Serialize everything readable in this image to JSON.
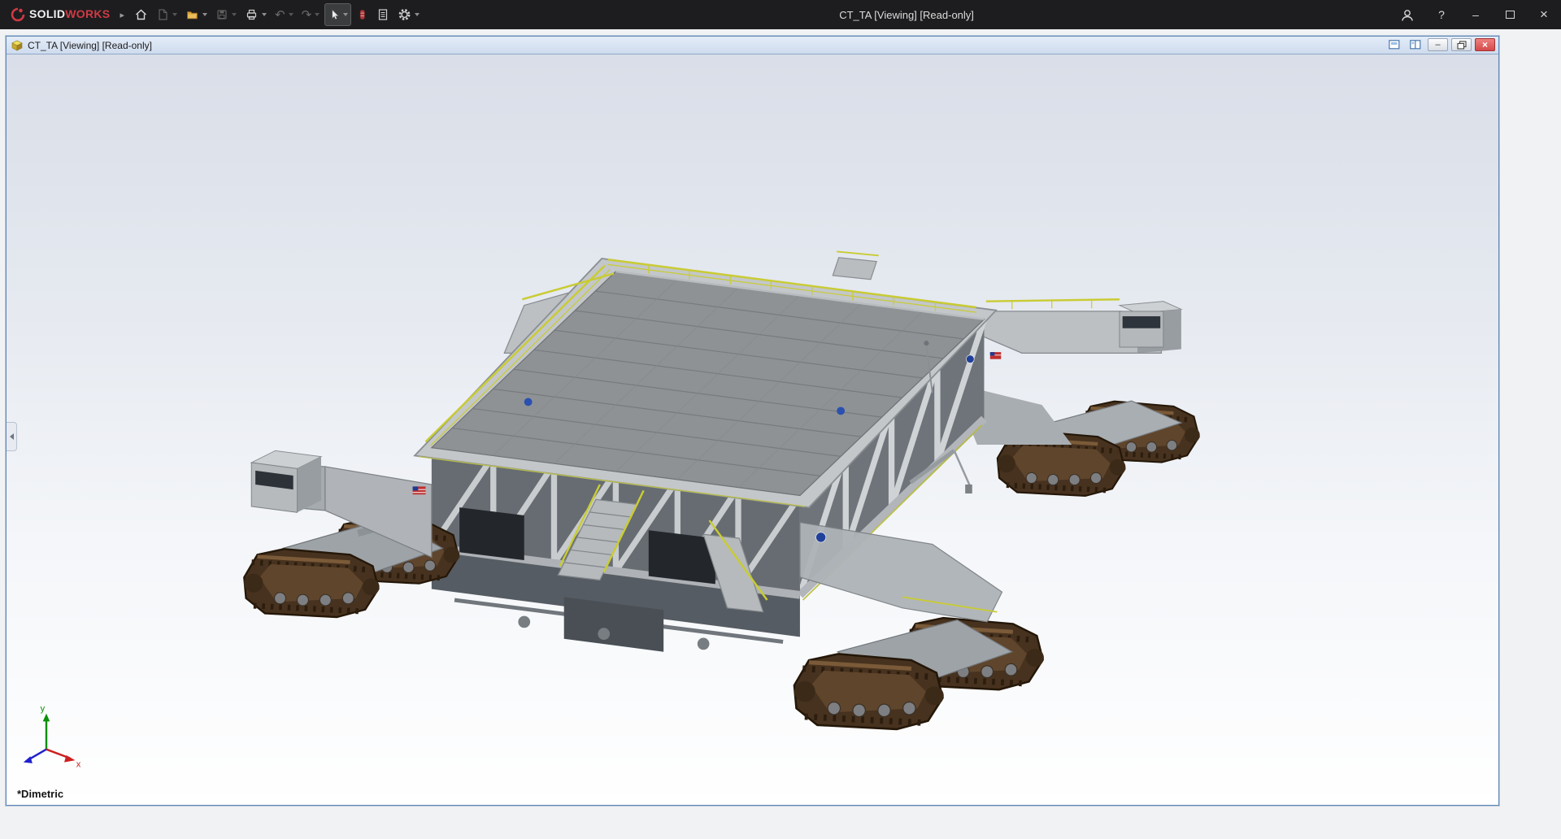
{
  "app": {
    "title": "CT_TA [Viewing] [Read-only]",
    "brand": {
      "bold": "SOLID",
      "red": "WORKS",
      "logo": "dassault-3ds-logo"
    },
    "menu_arrow": "▸",
    "toolbar": {
      "glyphs": {
        "undo": "↶",
        "redo": "↷"
      },
      "buttons": [
        {
          "id": "home",
          "icon": "house-icon",
          "enabled": true,
          "dropdown": false
        },
        {
          "id": "new-document",
          "icon": "new-page-icon",
          "enabled": false,
          "dropdown": true
        },
        {
          "id": "open",
          "icon": "open-folder-icon",
          "enabled": true,
          "dropdown": true
        },
        {
          "id": "save",
          "icon": "floppy-disk-icon",
          "enabled": false,
          "dropdown": true
        },
        {
          "id": "print",
          "icon": "printer-icon",
          "enabled": true,
          "dropdown": true
        },
        {
          "id": "undo",
          "icon": "undo-arrow-icon",
          "enabled": false,
          "dropdown": true
        },
        {
          "id": "redo",
          "icon": "redo-arrow-icon",
          "enabled": false,
          "dropdown": true
        },
        {
          "id": "select",
          "icon": "cursor-arrow-icon",
          "enabled": true,
          "active": true,
          "dropdown": true
        },
        {
          "id": "red-tool",
          "icon": "red-badge-icon",
          "enabled": true,
          "dropdown": false
        },
        {
          "id": "file-properties",
          "icon": "document-lines-icon",
          "enabled": true,
          "dropdown": false
        },
        {
          "id": "options",
          "icon": "gear-icon",
          "enabled": true,
          "dropdown": true
        }
      ]
    },
    "window_controls": {
      "help": "?",
      "minimize": "–",
      "close": "×"
    }
  },
  "document": {
    "title": "CT_TA [Viewing] [Read-only]",
    "minimize_glyph": "–",
    "close_glyph": "×"
  },
  "viewport": {
    "orientation_label": "*Dimetric",
    "triad": {
      "x_label": "x",
      "y_label": "y"
    },
    "subject": "crawler-transporter-3d-assembly"
  },
  "colors": {
    "titlebar": "#1d1d1f",
    "doc_titlebar": "#d7e2f2",
    "accent_blue": "#5f87b5",
    "close_red": "#d44a4a",
    "track_brown": "#4a3422",
    "deck_gray": "#8e9295",
    "truss_gray": "#b9bdc0",
    "railing_yellow": "#c9cc32"
  }
}
